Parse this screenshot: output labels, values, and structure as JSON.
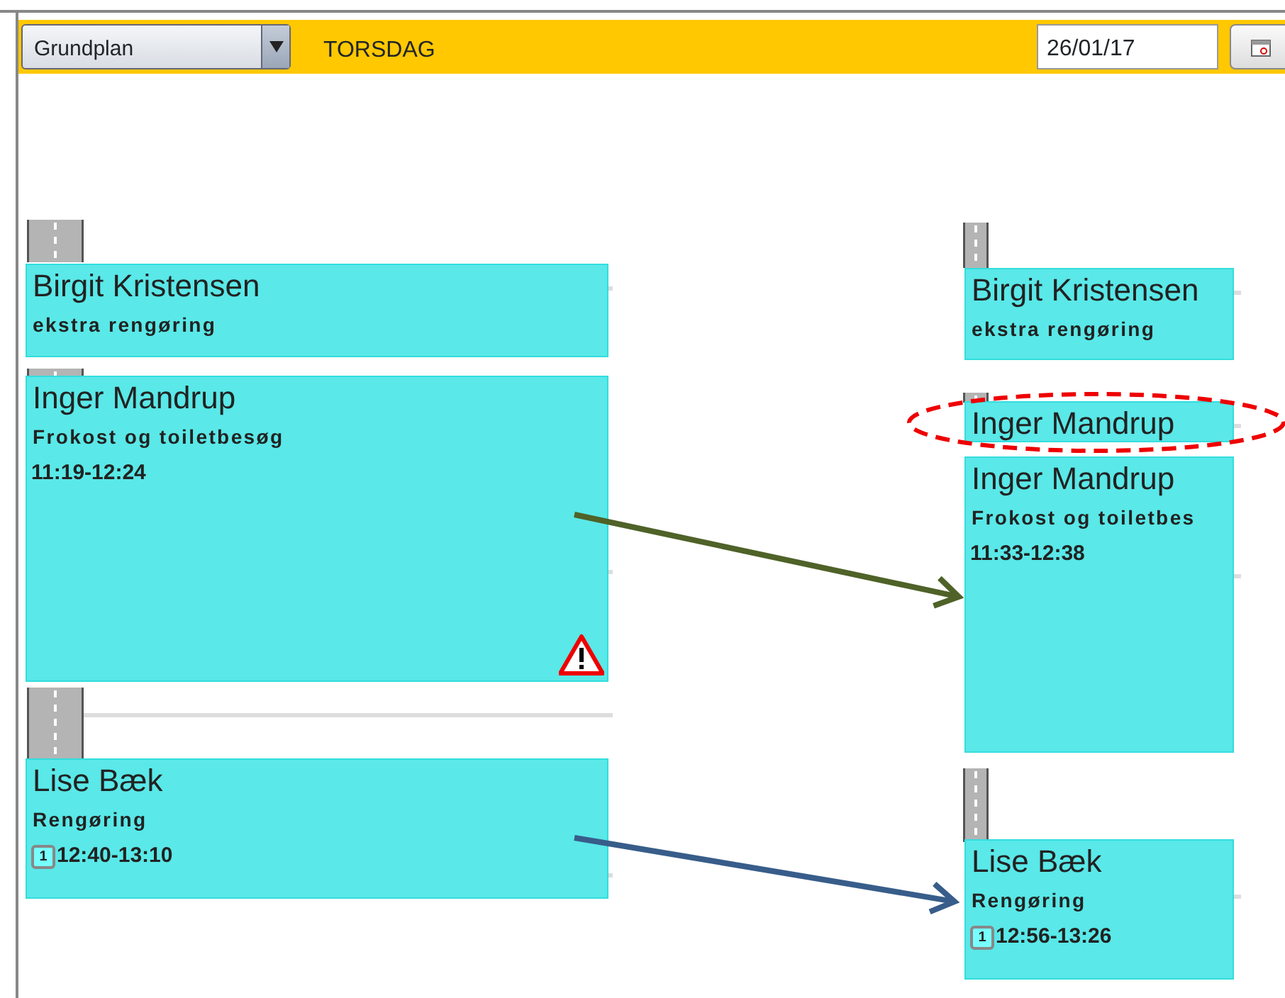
{
  "toolbar": {
    "plan_select": "Grundplan",
    "day": "TORSDAG",
    "date": "26/01/17"
  },
  "columns": [
    {
      "visits": [
        {
          "name": "Birgit Kristensen",
          "activity": "ekstra rengøring",
          "warning": false
        },
        {
          "name": "Inger Mandrup",
          "activity": "Frokost og toiletbesøg",
          "time": "11:19-12:24",
          "warning": true
        },
        {
          "name": "Lise Bæk",
          "activity": "Rengøring",
          "badge": "1",
          "time": "12:40-13:10",
          "warning": false
        }
      ]
    },
    {
      "visits": [
        {
          "name": "Birgit Kristensen",
          "activity": "ekstra rengøring",
          "warning": false
        },
        {
          "name": "Inger Mandrup",
          "warning": false
        },
        {
          "name": "Inger Mandrup",
          "activity": "Frokost og toiletbes",
          "time": "11:33-12:38",
          "warning": false
        },
        {
          "name": "Lise Bæk",
          "activity": "Rengøring",
          "badge": "1",
          "time": "12:56-13:26",
          "warning": false
        }
      ]
    }
  ],
  "arrows": [
    {
      "color": "#4f6228"
    },
    {
      "color": "#385d8a"
    }
  ]
}
